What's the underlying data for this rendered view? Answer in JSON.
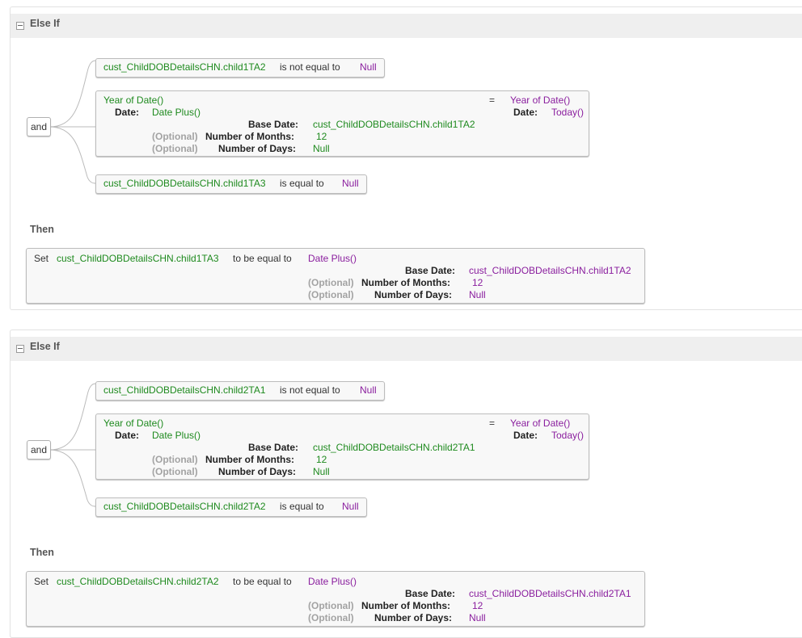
{
  "blocks": [
    {
      "header": "Else If",
      "operator": "and",
      "cond1": {
        "field": "cust_ChildDOBDetailsCHN.child1TA2",
        "op": "is not equal to",
        "value": "Null"
      },
      "cond2": {
        "left_func": "Year of Date()",
        "date_label": "Date:",
        "date_func": "Date Plus()",
        "base_date_label": "Base Date:",
        "base_date": "cust_ChildDOBDetailsCHN.child1TA2",
        "optional": "(Optional)",
        "months_label": "Number of Months:",
        "months": "12",
        "days_label": "Number of Days:",
        "days": "Null",
        "eq": "=",
        "right_func": "Year of Date()",
        "right_date_label": "Date:",
        "right_date_func": "Today()"
      },
      "cond3": {
        "field": "cust_ChildDOBDetailsCHN.child1TA3",
        "op": "is equal to",
        "value": "Null"
      },
      "then_label": "Then",
      "action": {
        "set": "Set",
        "field": "cust_ChildDOBDetailsCHN.child1TA3",
        "op": "to be equal to",
        "func": "Date Plus()",
        "base_date_label": "Base Date:",
        "base_date": "cust_ChildDOBDetailsCHN.child1TA2",
        "optional": "(Optional)",
        "months_label": "Number of Months:",
        "months": "12",
        "days_label": "Number of Days:",
        "days": "Null"
      }
    },
    {
      "header": "Else If",
      "operator": "and",
      "cond1": {
        "field": "cust_ChildDOBDetailsCHN.child2TA1",
        "op": "is not equal to",
        "value": "Null"
      },
      "cond2": {
        "left_func": "Year of Date()",
        "date_label": "Date:",
        "date_func": "Date Plus()",
        "base_date_label": "Base Date:",
        "base_date": "cust_ChildDOBDetailsCHN.child2TA1",
        "optional": "(Optional)",
        "months_label": "Number of Months:",
        "months": "12",
        "days_label": "Number of Days:",
        "days": "Null",
        "eq": "=",
        "right_func": "Year of Date()",
        "right_date_label": "Date:",
        "right_date_func": "Today()"
      },
      "cond3": {
        "field": "cust_ChildDOBDetailsCHN.child2TA2",
        "op": "is equal to",
        "value": "Null"
      },
      "then_label": "Then",
      "action": {
        "set": "Set",
        "field": "cust_ChildDOBDetailsCHN.child2TA2",
        "op": "to be equal to",
        "func": "Date Plus()",
        "base_date_label": "Base Date:",
        "base_date": "cust_ChildDOBDetailsCHN.child2TA1",
        "optional": "(Optional)",
        "months_label": "Number of Months:",
        "months": "12",
        "days_label": "Number of Days:",
        "days": "Null"
      }
    }
  ],
  "colors": {
    "field": "#1e8a1e",
    "value": "#8a1e9e",
    "optional": "#a3a3a3",
    "header_bg": "#efefef"
  }
}
